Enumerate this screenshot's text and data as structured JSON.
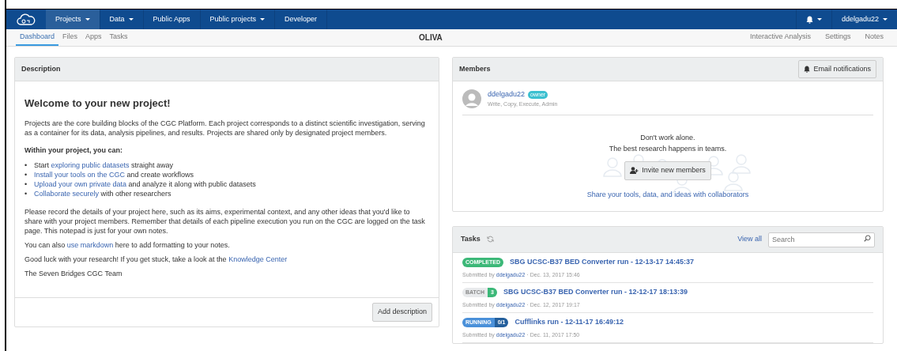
{
  "topnav": {
    "items": [
      {
        "label": "Projects",
        "dropdown": true,
        "selected": true
      },
      {
        "label": "Data",
        "dropdown": true,
        "selected": false
      },
      {
        "label": "Public Apps",
        "dropdown": false,
        "selected": false
      },
      {
        "label": "Public projects",
        "dropdown": true,
        "selected": false
      },
      {
        "label": "Developer",
        "dropdown": false,
        "selected": false
      }
    ],
    "user": "ddelgadu22"
  },
  "subnav": {
    "tabs": [
      {
        "label": "Dashboard",
        "selected": true
      },
      {
        "label": "Files",
        "selected": false
      },
      {
        "label": "Apps",
        "selected": false
      },
      {
        "label": "Tasks",
        "selected": false
      }
    ],
    "title": "OLIVA",
    "right_links": [
      "Interactive Analysis",
      "Settings",
      "Notes"
    ]
  },
  "description": {
    "title": "Description",
    "heading": "Welcome to your new project!",
    "blocks": [
      {
        "kind": "para",
        "parts": [
          {
            "text": "Projects are the core building blocks of the CGC Platform. Each project corresponds to a distinct scientific investigation, serving as a container for its data, analysis pipelines, and results. Projects are shared only by designated project members.",
            "link": false
          }
        ]
      },
      {
        "kind": "subheading",
        "parts": [
          {
            "text": "Within your project, you can:",
            "link": false
          }
        ]
      },
      {
        "kind": "bullet",
        "marker": "•",
        "parts": [
          {
            "text": "Start ",
            "link": false
          },
          {
            "text": "exploring public datasets",
            "link": true
          },
          {
            "text": " straight away",
            "link": false
          }
        ]
      },
      {
        "kind": "bullet",
        "marker": "•",
        "parts": [
          {
            "text": "Install your tools on the CGC",
            "link": true
          },
          {
            "text": " and create workflows",
            "link": false
          }
        ]
      },
      {
        "kind": "bullet",
        "marker": "•",
        "parts": [
          {
            "text": "Upload your own private data",
            "link": true
          },
          {
            "text": " and analyze it along with public datasets",
            "link": false
          }
        ]
      },
      {
        "kind": "bullet",
        "marker": "•",
        "parts": [
          {
            "text": "Collaborate securely",
            "link": true
          },
          {
            "text": " with other researchers",
            "link": false
          }
        ]
      },
      {
        "kind": "para",
        "parts": [
          {
            "text": "Please record the details of your project here, such as its aims, experimental context, and any other ideas that you'd like to share with your project members. Remember that details of each pipeline execution you run on the CGC are logged on the task page. This notepad is just for your own notes.",
            "link": false
          }
        ]
      },
      {
        "kind": "para",
        "parts": [
          {
            "text": "You can also ",
            "link": false
          },
          {
            "text": "use markdown",
            "link": true
          },
          {
            "text": " here to add formatting to your notes.",
            "link": false
          }
        ]
      },
      {
        "kind": "para",
        "parts": [
          {
            "text": "Good luck with your research! If you get stuck, take a look at the ",
            "link": false
          },
          {
            "text": "Knowledge Center",
            "link": true
          }
        ]
      },
      {
        "kind": "para",
        "parts": [
          {
            "text": "The Seven Bridges CGC Team",
            "link": false
          }
        ]
      }
    ],
    "button": "Add description"
  },
  "members": {
    "title": "Members",
    "notify_button": "Email notifications",
    "member": {
      "name": "ddelgadu22",
      "role_badge": "owner",
      "permissions": "Write, Copy, Execute, Admin"
    },
    "empty_lines": [
      "Don't work alone.",
      "The best research happens in teams."
    ],
    "invite_button": "Invite new members",
    "share_link": "Share your tools, data, and ideas with collaborators"
  },
  "tasks": {
    "title": "Tasks",
    "view_all": "View all",
    "search": {
      "placeholder": "Search"
    },
    "items": [
      {
        "status": "COMPLETED",
        "kind": "completed",
        "name": "SBG UCSC-B37 BED Converter run - 12-13-17 14:45:37",
        "submitted_label": "Submitted by",
        "user": "ddelgadu22",
        "date": "· Dec. 13, 2017 15:46"
      },
      {
        "status": "BATCH",
        "kind": "batch",
        "count": "3",
        "name": "SBG UCSC-B37 BED Converter run - 12-12-17 18:13:39",
        "submitted_label": "Submitted by",
        "user": "ddelgadu22",
        "date": "· Dec. 12, 2017 19:17"
      },
      {
        "status": "RUNNING",
        "kind": "running",
        "count": "0/1",
        "name": "Cufflinks run - 12-11-17 16:49:12",
        "submitted_label": "Submitted by",
        "user": "ddelgadu22",
        "date": "· Dec. 11, 2017 17:50"
      }
    ]
  }
}
